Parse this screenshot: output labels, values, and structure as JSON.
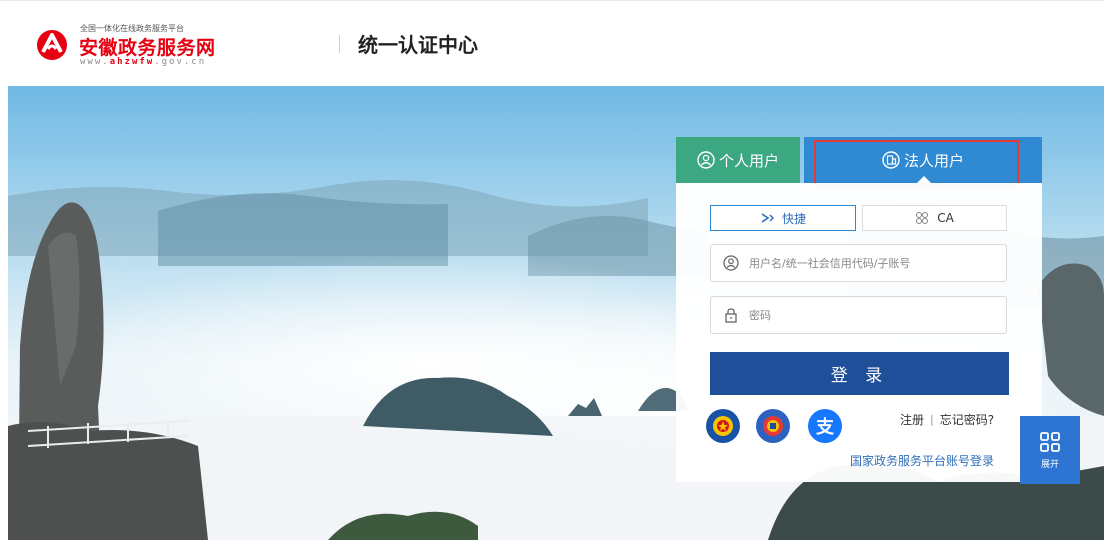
{
  "header": {
    "logo_small": "全国一体化在线政务服务平台",
    "logo_main": "安徽政务服务网",
    "logo_url_prefix": "www.",
    "logo_url_brand": "ahzwfw",
    "logo_url_suffix": ".gov.cn",
    "portal_title": "统一认证中心"
  },
  "login": {
    "tabs": [
      {
        "label": "个人用户",
        "icon": "person-circle-icon",
        "color": "#3ba882"
      },
      {
        "label": "法人用户",
        "icon": "building-circle-icon",
        "color": "#2f89d3",
        "active": true
      }
    ],
    "modes": [
      {
        "label": "快捷",
        "icon": "quick-icon",
        "active": true
      },
      {
        "label": "CA",
        "icon": "ca-icon"
      }
    ],
    "username_placeholder": "用户名/统一社会信用代码/子账号",
    "password_placeholder": "密码",
    "submit_label": "登 录",
    "third_party": [
      "police-emblem-icon",
      "tax-emblem-icon",
      "alipay-icon"
    ],
    "alipay_glyph": "支",
    "register_label": "注册",
    "link_separator": "|",
    "forgot_label": "忘记密码?",
    "national_login": "国家政务服务平台账号登录"
  },
  "side_panel": {
    "label": "展开",
    "icon": "grid-icon"
  },
  "colors": {
    "accent": "#2f89d3",
    "personal": "#3ba882",
    "button": "#1f4f99",
    "brand_red": "#e60012"
  }
}
